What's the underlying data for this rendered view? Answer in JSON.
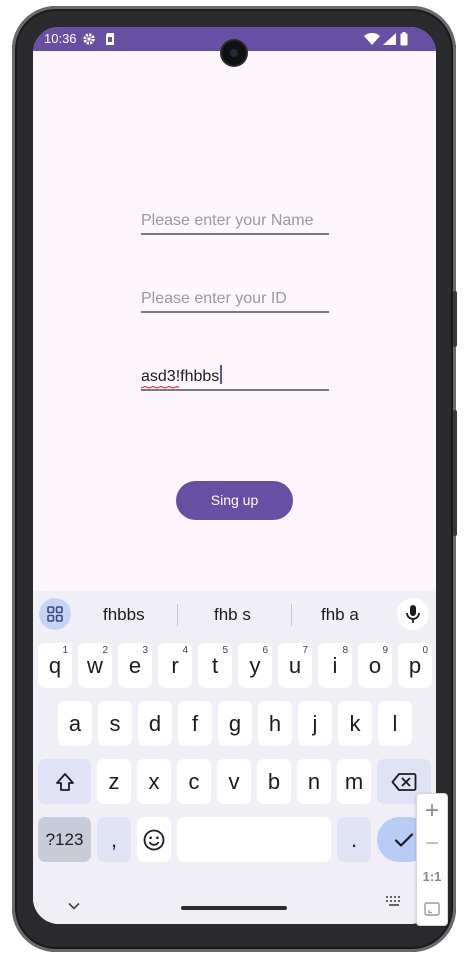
{
  "status_bar": {
    "time": "10:36",
    "left_icons": [
      "gear-icon",
      "sim-card-icon"
    ],
    "right_icons": [
      "wifi-icon",
      "signal-icon",
      "battery-icon"
    ],
    "color": "#6750a4"
  },
  "form": {
    "name_placeholder": "Please enter your Name",
    "id_placeholder": "Please enter your ID",
    "third_value": "asd3!fhbbs",
    "signup_label": "Sing up",
    "accent": "#6750a4"
  },
  "keyboard": {
    "suggestions": [
      "fhbbs",
      "fhb s",
      "fhb a"
    ],
    "row1": [
      {
        "k": "q",
        "h": "1"
      },
      {
        "k": "w",
        "h": "2"
      },
      {
        "k": "e",
        "h": "3"
      },
      {
        "k": "r",
        "h": "4"
      },
      {
        "k": "t",
        "h": "5"
      },
      {
        "k": "y",
        "h": "6"
      },
      {
        "k": "u",
        "h": "7"
      },
      {
        "k": "i",
        "h": "8"
      },
      {
        "k": "o",
        "h": "9"
      },
      {
        "k": "p",
        "h": "0"
      }
    ],
    "row2": [
      "a",
      "s",
      "d",
      "f",
      "g",
      "h",
      "j",
      "k",
      "l"
    ],
    "row3": [
      "z",
      "x",
      "c",
      "v",
      "b",
      "n",
      "m"
    ],
    "symbols_label": "?123",
    "comma": ",",
    "period": "."
  },
  "emulator_toolbar": {
    "zoom_in": "+",
    "zoom_out": "−",
    "ratio": "1:1"
  }
}
